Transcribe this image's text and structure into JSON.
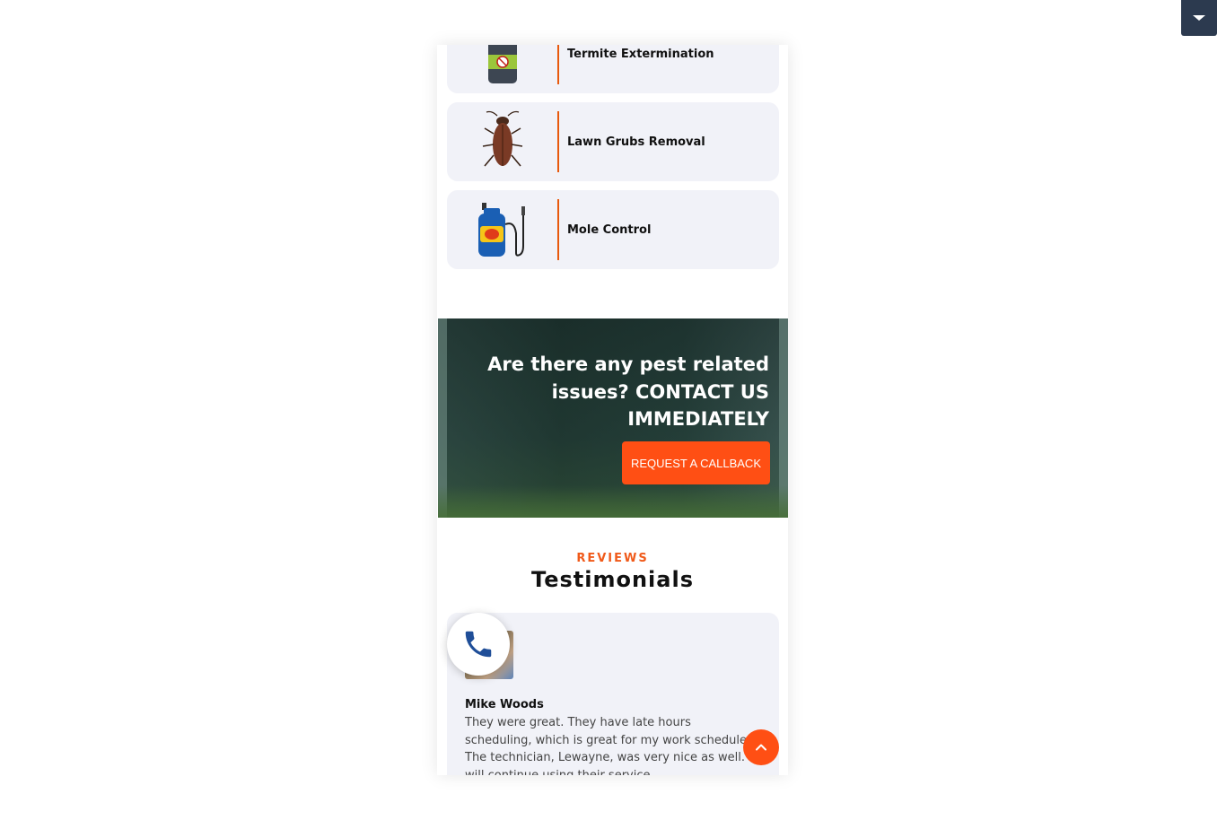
{
  "services": [
    {
      "label": "Termite Extermination",
      "icon": "termite-spray-bottle-icon"
    },
    {
      "label": "Lawn Grubs Removal",
      "icon": "cockroach-icon"
    },
    {
      "label": "Mole Control",
      "icon": "pump-sprayer-icon"
    }
  ],
  "cta": {
    "headline": "Are there any pest related issues? CONTACT US IMMEDIATELY",
    "button_label": "REQUEST A CALLBACK"
  },
  "reviews": {
    "kicker": "REVIEWS",
    "title": "Testimonials",
    "items": [
      {
        "name": "Mike Woods",
        "text": "They were great. They have late hours scheduling, which is great for my work schedule. The technician, Lewayne, was very nice as well. I will continue using their service."
      }
    ]
  },
  "colors": {
    "accent": "#ff4f14",
    "card_bg": "#f1f2f8",
    "toggle_bg": "#2c3a4f",
    "phone_icon": "#1f4e98"
  },
  "floating": {
    "phone_icon": "phone-icon",
    "scroll_top_icon": "chevron-up-icon",
    "top_toggle_icon": "caret-down-icon"
  }
}
